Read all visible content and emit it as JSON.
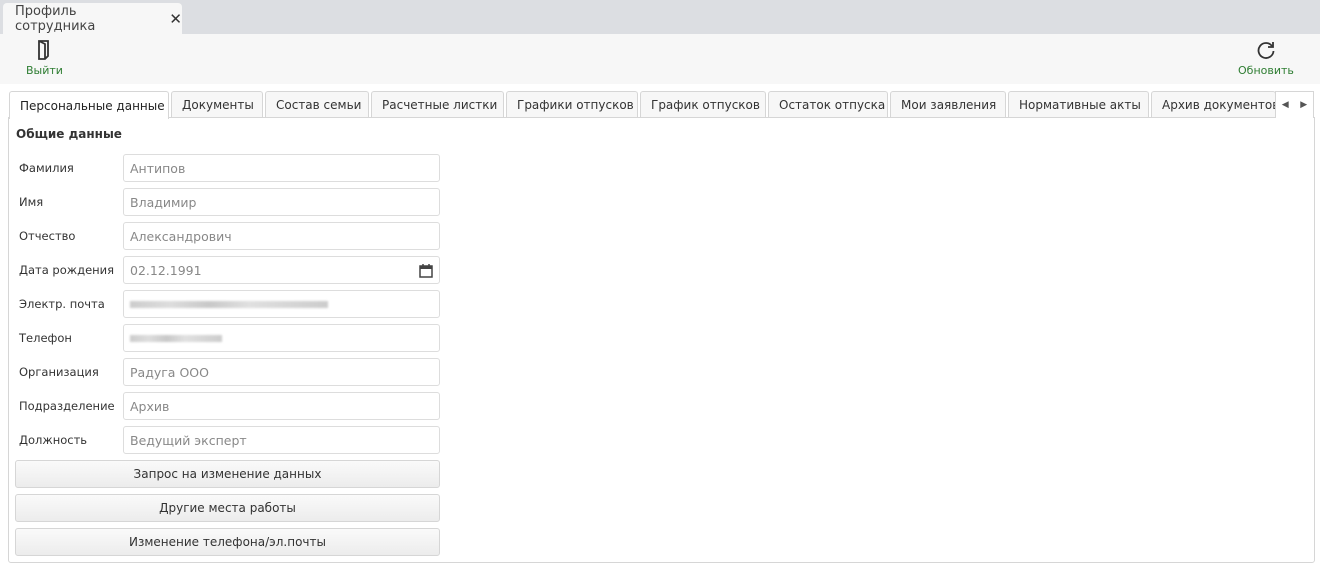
{
  "window_tab": {
    "title": "Профиль сотрудника",
    "close_icon": "close-icon"
  },
  "toolbar": {
    "exit_label": "Выйти",
    "refresh_label": "Обновить",
    "accent": "#2e7d32"
  },
  "tabs": [
    "Персональные данные",
    "Документы",
    "Состав семьи",
    "Расчетные листки",
    "Графики отпусков",
    "График отпусков",
    "Остаток отпуска",
    "Мои заявления",
    "Нормативные акты",
    "Архив документов"
  ],
  "section_title": "Общие данные",
  "fields": [
    {
      "label": "Фамилия",
      "value": "Антипов"
    },
    {
      "label": "Имя",
      "value": "Владимир"
    },
    {
      "label": "Отчество",
      "value": "Александрович"
    },
    {
      "label": "Дата рождения",
      "value": "02.12.1991"
    },
    {
      "label": "Электр. почта",
      "value": null
    },
    {
      "label": "Телефон",
      "value": null
    },
    {
      "label": "Организация",
      "value": "Радуга ООО"
    },
    {
      "label": "Подразделение",
      "value": "Архив"
    },
    {
      "label": "Должность",
      "value": "Ведущий эксперт"
    }
  ],
  "buttons": [
    "Запрос на изменение данных",
    "Другие места работы",
    "Изменение телефона/эл.почты"
  ]
}
